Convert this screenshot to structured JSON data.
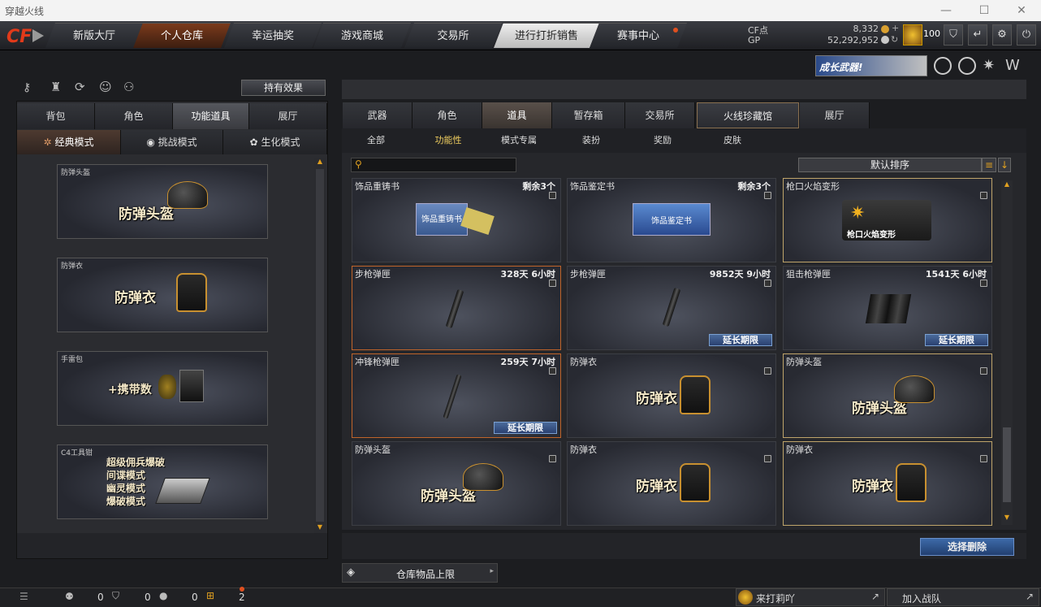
{
  "window": {
    "title": "穿越火线",
    "minimize": "—",
    "maximize": "☐",
    "close": "✕"
  },
  "nav": {
    "tabs": [
      "新版大厅",
      "个人仓库",
      "幸运抽奖",
      "游戏商城",
      "交易所",
      "进行打折销售",
      "赛事中心"
    ],
    "cf_label": "CF点",
    "cf_value": "8,332",
    "gp_label": "GP",
    "gp_value": "52,292,952",
    "level": "100"
  },
  "banner": {
    "text": "成长武器!"
  },
  "left": {
    "effect_button": "持有效果",
    "tabs": [
      "背包",
      "角色",
      "功能道具",
      "展厅"
    ],
    "modes": [
      "经典模式",
      "挑战模式",
      "生化模式"
    ],
    "items": [
      {
        "label": "防弹头盔",
        "title": "防弹头盔"
      },
      {
        "label": "防弹衣",
        "title": "防弹衣"
      },
      {
        "label": "手雷包",
        "title": "+携带数"
      },
      {
        "label": "C4工具钳",
        "lines": [
          "超级佣兵爆破",
          "间谍模式",
          "幽灵模式",
          "爆破模式"
        ]
      }
    ]
  },
  "right": {
    "tabs": [
      "武器",
      "角色",
      "道具",
      "暂存箱",
      "交易所",
      "火线珍藏馆",
      "展厅"
    ],
    "subtabs": [
      "全部",
      "功能性",
      "模式专属",
      "装扮",
      "奖励",
      "皮肤"
    ],
    "sort": "默认排序",
    "cards": [
      {
        "name": "饰品重铸书",
        "time": "剩余3个",
        "art": "饰品重铸书"
      },
      {
        "name": "饰品鉴定书",
        "time": "剩余3个",
        "art": "饰品鉴定书"
      },
      {
        "name": "枪口火焰变形",
        "time": "",
        "art": "枪口火焰变形"
      },
      {
        "name": "步枪弹匣",
        "time": "328天 6小时",
        "ext": ""
      },
      {
        "name": "步枪弹匣",
        "time": "9852天 9小时",
        "ext": "延长期限"
      },
      {
        "name": "狙击枪弹匣",
        "time": "1541天 6小时",
        "ext": "延长期限"
      },
      {
        "name": "冲锋枪弹匣",
        "time": "259天 7小时",
        "ext": "延长期限"
      },
      {
        "name": "防弹衣",
        "time": "",
        "art": "防弹衣"
      },
      {
        "name": "防弹头盔",
        "time": "",
        "art": "防弹头盔"
      },
      {
        "name": "防弹头盔",
        "time": "",
        "art": "防弹头盔"
      },
      {
        "name": "防弹衣",
        "time": "",
        "art": "防弹衣"
      },
      {
        "name": "防弹衣",
        "time": "",
        "art": "防弹衣"
      }
    ],
    "select_delete": "选择删除",
    "warehouse_limit": "仓库物品上限"
  },
  "bottom": {
    "c1": "0",
    "c2": "0",
    "c3": "0",
    "c4": "2",
    "news": "来打莉吖",
    "join": "加入战队"
  }
}
